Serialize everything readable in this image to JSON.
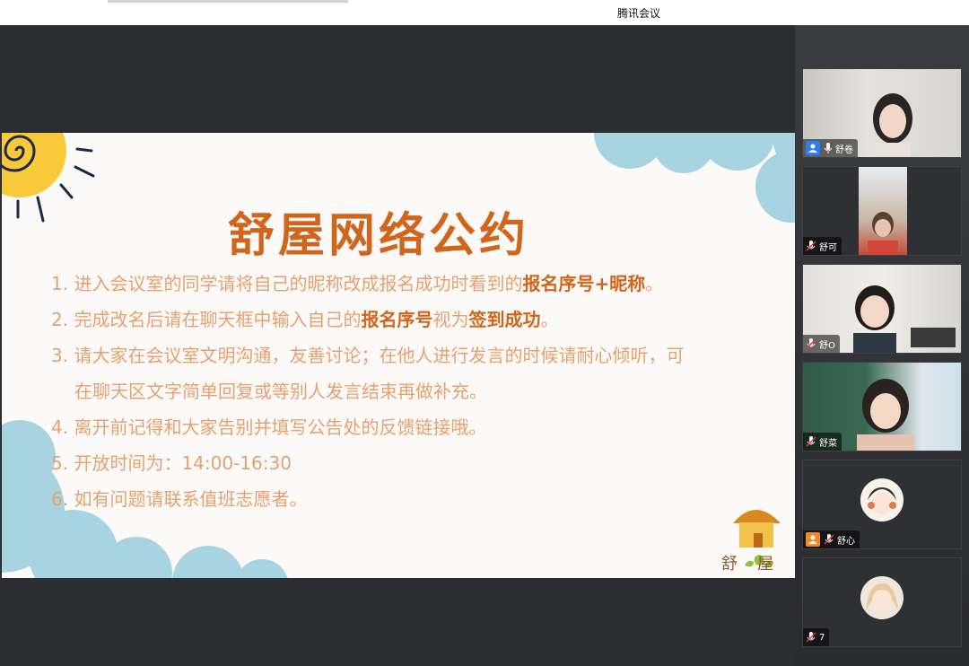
{
  "window": {
    "title": "腾讯会议"
  },
  "slide": {
    "title": "舒屋网络公约",
    "rules": [
      {
        "parts": [
          {
            "text": "1. 进入会议室的同学请将自己的昵称改成报名成功时看到的"
          },
          {
            "text": "报名序号+昵称",
            "strong": true
          },
          {
            "text": "。"
          }
        ]
      },
      {
        "parts": [
          {
            "text": "2. 完成改名后请在聊天框中输入自己的"
          },
          {
            "text": "报名序号",
            "strong": true
          },
          {
            "text": "视为"
          },
          {
            "text": "签到成功",
            "strong": true
          },
          {
            "text": "。"
          }
        ]
      },
      {
        "parts": [
          {
            "text": "3. 请大家在会议室文明沟通，友善讨论；在他人进行发言的时候请耐心倾听，可"
          }
        ]
      },
      {
        "indent": true,
        "parts": [
          {
            "text": "在聊天区文字简单回复或等别人发言结束再做补充。"
          }
        ]
      },
      {
        "parts": [
          {
            "text": "4. 离开前记得和大家告别并填写公告处的反馈链接哦。"
          }
        ]
      },
      {
        "parts": [
          {
            "text": "5. 开放时间为：14:00-16:30"
          }
        ]
      },
      {
        "parts": [
          {
            "text": "6. 如有问题请联系值班志愿者。"
          }
        ]
      }
    ],
    "logo_text": "舒屋"
  },
  "participants": [
    {
      "name": "舒卷",
      "badge": "user-icon",
      "badge_color": "#2d7df6",
      "type": "video",
      "mic": "mic-on"
    },
    {
      "name": "舒可",
      "type": "video",
      "mic": "mic-muted"
    },
    {
      "name": "舒O",
      "type": "video",
      "mic": "mic-muted"
    },
    {
      "name": "舒菜",
      "type": "video",
      "mic": "mic-muted"
    },
    {
      "name": "舒心",
      "badge": "user-icon",
      "badge_color": "#f08a24",
      "type": "avatar",
      "mic": "mic-muted"
    },
    {
      "name": "7",
      "type": "avatar",
      "mic": "mic-muted"
    }
  ],
  "colors": {
    "accent": "#d2651c",
    "rule_text": "#e9a070",
    "cloud": "#a8d3e0",
    "sun": "#f8c93a",
    "meeting_bg": "#2b2d31"
  }
}
